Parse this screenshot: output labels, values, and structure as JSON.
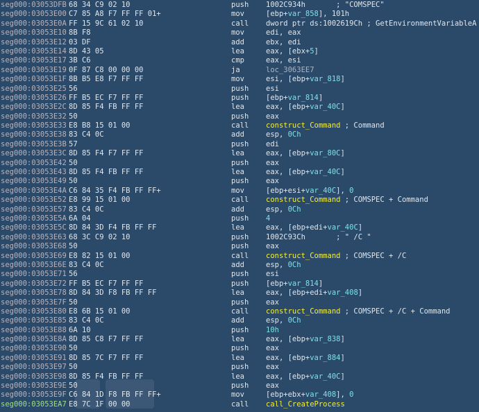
{
  "listing": {
    "rows": [
      {
        "addr": "seg000:03053DFB",
        "bytes": "68 34 C9 02 10",
        "mnemonic": "push",
        "ops": [
          {
            "t": "1002C934h       ; \"COMSPEC\"",
            "c": "plain"
          }
        ]
      },
      {
        "addr": "seg000:03053E00",
        "bytes": "C7 85 A8 F7 FF FF 01+",
        "mnemonic": "mov",
        "ops": [
          {
            "t": "[ebp+",
            "c": "plain"
          },
          {
            "t": "var_858",
            "c": "var"
          },
          {
            "t": "], 101h",
            "c": "plain"
          }
        ]
      },
      {
        "addr": "seg000:03053E0A",
        "bytes": "FF 15 9C 61 02 10",
        "mnemonic": "call",
        "ops": [
          {
            "t": "dword ptr ds:1002619Ch ; GetEnvironmentVariableA",
            "c": "plain"
          }
        ]
      },
      {
        "addr": "seg000:03053E10",
        "bytes": "8B F8",
        "mnemonic": "mov",
        "ops": [
          {
            "t": "edi, eax",
            "c": "plain"
          }
        ]
      },
      {
        "addr": "seg000:03053E12",
        "bytes": "03 DF",
        "mnemonic": "add",
        "ops": [
          {
            "t": "ebx, edi",
            "c": "plain"
          }
        ]
      },
      {
        "addr": "seg000:03053E14",
        "bytes": "8D 43 05",
        "mnemonic": "lea",
        "ops": [
          {
            "t": "eax, [ebx+",
            "c": "plain"
          },
          {
            "t": "5",
            "c": "num"
          },
          {
            "t": "]",
            "c": "plain"
          }
        ]
      },
      {
        "addr": "seg000:03053E17",
        "bytes": "3B C6",
        "mnemonic": "cmp",
        "ops": [
          {
            "t": "eax, esi",
            "c": "plain"
          }
        ]
      },
      {
        "addr": "seg000:03053E19",
        "bytes": "0F 87 C8 00 00 00",
        "mnemonic": "ja",
        "ops": [
          {
            "t": "loc_3063EE7",
            "c": "loc"
          }
        ]
      },
      {
        "addr": "seg000:03053E1F",
        "bytes": "8B B5 E8 F7 FF FF",
        "mnemonic": "mov",
        "ops": [
          {
            "t": "esi, [ebp+",
            "c": "plain"
          },
          {
            "t": "var_818",
            "c": "var"
          },
          {
            "t": "]",
            "c": "plain"
          }
        ]
      },
      {
        "addr": "seg000:03053E25",
        "bytes": "56",
        "mnemonic": "push",
        "ops": [
          {
            "t": "esi",
            "c": "plain"
          }
        ]
      },
      {
        "addr": "seg000:03053E26",
        "bytes": "FF B5 EC F7 FF FF",
        "mnemonic": "push",
        "ops": [
          {
            "t": "[ebp+",
            "c": "plain"
          },
          {
            "t": "var_814",
            "c": "var"
          },
          {
            "t": "]",
            "c": "plain"
          }
        ]
      },
      {
        "addr": "seg000:03053E2C",
        "bytes": "8D 85 F4 FB FF FF",
        "mnemonic": "lea",
        "ops": [
          {
            "t": "eax, [ebp+",
            "c": "plain"
          },
          {
            "t": "var_40C",
            "c": "var"
          },
          {
            "t": "]",
            "c": "plain"
          }
        ]
      },
      {
        "addr": "seg000:03053E32",
        "bytes": "50",
        "mnemonic": "push",
        "ops": [
          {
            "t": "eax",
            "c": "plain"
          }
        ]
      },
      {
        "addr": "seg000:03053E33",
        "bytes": "E8 B8 15 01 00",
        "mnemonic": "call",
        "ops": [
          {
            "t": "construct_Command",
            "c": "func"
          },
          {
            "t": " ; Command",
            "c": "cmt"
          }
        ]
      },
      {
        "addr": "seg000:03053E38",
        "bytes": "83 C4 0C",
        "mnemonic": "add",
        "ops": [
          {
            "t": "esp, ",
            "c": "plain"
          },
          {
            "t": "0Ch",
            "c": "num"
          }
        ]
      },
      {
        "addr": "seg000:03053E3B",
        "bytes": "57",
        "mnemonic": "push",
        "ops": [
          {
            "t": "edi",
            "c": "plain"
          }
        ]
      },
      {
        "addr": "seg000:03053E3C",
        "bytes": "8D 85 F4 F7 FF FF",
        "mnemonic": "lea",
        "ops": [
          {
            "t": "eax, [ebp+",
            "c": "plain"
          },
          {
            "t": "var_80C",
            "c": "var"
          },
          {
            "t": "]",
            "c": "plain"
          }
        ]
      },
      {
        "addr": "seg000:03053E42",
        "bytes": "50",
        "mnemonic": "push",
        "ops": [
          {
            "t": "eax",
            "c": "plain"
          }
        ]
      },
      {
        "addr": "seg000:03053E43",
        "bytes": "8D 85 F4 FB FF FF",
        "mnemonic": "lea",
        "ops": [
          {
            "t": "eax, [ebp+",
            "c": "plain"
          },
          {
            "t": "var_40C",
            "c": "var"
          },
          {
            "t": "]",
            "c": "plain"
          }
        ]
      },
      {
        "addr": "seg000:03053E49",
        "bytes": "50",
        "mnemonic": "push",
        "ops": [
          {
            "t": "eax",
            "c": "plain"
          }
        ]
      },
      {
        "addr": "seg000:03053E4A",
        "bytes": "C6 84 35 F4 FB FF FF+",
        "mnemonic": "mov",
        "ops": [
          {
            "t": "[ebp+esi+",
            "c": "plain"
          },
          {
            "t": "var_40C",
            "c": "var"
          },
          {
            "t": "], ",
            "c": "plain"
          },
          {
            "t": "0",
            "c": "num"
          }
        ]
      },
      {
        "addr": "seg000:03053E52",
        "bytes": "E8 99 15 01 00",
        "mnemonic": "call",
        "ops": [
          {
            "t": "construct_Command",
            "c": "func"
          },
          {
            "t": " ; COMSPEC + Command",
            "c": "cmt"
          }
        ]
      },
      {
        "addr": "seg000:03053E57",
        "bytes": "83 C4 0C",
        "mnemonic": "add",
        "ops": [
          {
            "t": "esp, ",
            "c": "plain"
          },
          {
            "t": "0Ch",
            "c": "num"
          }
        ]
      },
      {
        "addr": "seg000:03053E5A",
        "bytes": "6A 04",
        "mnemonic": "push",
        "ops": [
          {
            "t": "4",
            "c": "num"
          }
        ]
      },
      {
        "addr": "seg000:03053E5C",
        "bytes": "8D 84 3D F4 FB FF FF",
        "mnemonic": "lea",
        "ops": [
          {
            "t": "eax, [ebp+edi+",
            "c": "plain"
          },
          {
            "t": "var_40C",
            "c": "var"
          },
          {
            "t": "]",
            "c": "plain"
          }
        ]
      },
      {
        "addr": "seg000:03053E63",
        "bytes": "68 3C C9 02 10",
        "mnemonic": "push",
        "ops": [
          {
            "t": "1002C93Ch       ; \" /C \"",
            "c": "plain"
          }
        ]
      },
      {
        "addr": "seg000:03053E68",
        "bytes": "50",
        "mnemonic": "push",
        "ops": [
          {
            "t": "eax",
            "c": "plain"
          }
        ]
      },
      {
        "addr": "seg000:03053E69",
        "bytes": "E8 82 15 01 00",
        "mnemonic": "call",
        "ops": [
          {
            "t": "construct_Command",
            "c": "func"
          },
          {
            "t": " ; COMSPEC + /C",
            "c": "cmt"
          }
        ]
      },
      {
        "addr": "seg000:03053E6E",
        "bytes": "83 C4 0C",
        "mnemonic": "add",
        "ops": [
          {
            "t": "esp, ",
            "c": "plain"
          },
          {
            "t": "0Ch",
            "c": "num"
          }
        ]
      },
      {
        "addr": "seg000:03053E71",
        "bytes": "56",
        "mnemonic": "push",
        "ops": [
          {
            "t": "esi",
            "c": "plain"
          }
        ]
      },
      {
        "addr": "seg000:03053E72",
        "bytes": "FF B5 EC F7 FF FF",
        "mnemonic": "push",
        "ops": [
          {
            "t": "[ebp+",
            "c": "plain"
          },
          {
            "t": "var_814",
            "c": "var"
          },
          {
            "t": "]",
            "c": "plain"
          }
        ]
      },
      {
        "addr": "seg000:03053E78",
        "bytes": "8D 84 3D F8 FB FF FF",
        "mnemonic": "lea",
        "ops": [
          {
            "t": "eax, [ebp+edi+",
            "c": "plain"
          },
          {
            "t": "var_408",
            "c": "var"
          },
          {
            "t": "]",
            "c": "plain"
          }
        ]
      },
      {
        "addr": "seg000:03053E7F",
        "bytes": "50",
        "mnemonic": "push",
        "ops": [
          {
            "t": "eax",
            "c": "plain"
          }
        ]
      },
      {
        "addr": "seg000:03053E80",
        "bytes": "E8 6B 15 01 00",
        "mnemonic": "call",
        "ops": [
          {
            "t": "construct_Command",
            "c": "func"
          },
          {
            "t": " ; COMSPEC + /C + Command",
            "c": "cmt"
          }
        ]
      },
      {
        "addr": "seg000:03053E85",
        "bytes": "83 C4 0C",
        "mnemonic": "add",
        "ops": [
          {
            "t": "esp, ",
            "c": "plain"
          },
          {
            "t": "0Ch",
            "c": "num"
          }
        ]
      },
      {
        "addr": "seg000:03053E88",
        "bytes": "6A 10",
        "mnemonic": "push",
        "ops": [
          {
            "t": "10h",
            "c": "num"
          }
        ]
      },
      {
        "addr": "seg000:03053E8A",
        "bytes": "8D 85 C8 F7 FF FF",
        "mnemonic": "lea",
        "ops": [
          {
            "t": "eax, [ebp+",
            "c": "plain"
          },
          {
            "t": "var_838",
            "c": "var"
          },
          {
            "t": "]",
            "c": "plain"
          }
        ]
      },
      {
        "addr": "seg000:03053E90",
        "bytes": "50",
        "mnemonic": "push",
        "ops": [
          {
            "t": "eax",
            "c": "plain"
          }
        ]
      },
      {
        "addr": "seg000:03053E91",
        "bytes": "8D 85 7C F7 FF FF",
        "mnemonic": "lea",
        "ops": [
          {
            "t": "eax, [ebp+",
            "c": "plain"
          },
          {
            "t": "var_884",
            "c": "var"
          },
          {
            "t": "]",
            "c": "plain"
          }
        ]
      },
      {
        "addr": "seg000:03053E97",
        "bytes": "50",
        "mnemonic": "push",
        "ops": [
          {
            "t": "eax",
            "c": "plain"
          }
        ]
      },
      {
        "addr": "seg000:03053E98",
        "bytes": "8D 85 F4 FB FF FF",
        "mnemonic": "lea",
        "ops": [
          {
            "t": "eax, [ebp+",
            "c": "plain"
          },
          {
            "t": "var_40C",
            "c": "var"
          },
          {
            "t": "]",
            "c": "plain"
          }
        ]
      },
      {
        "addr": "seg000:03053E9E",
        "bytes": "50",
        "mnemonic": "push",
        "ops": [
          {
            "t": "eax",
            "c": "plain"
          }
        ]
      },
      {
        "addr": "seg000:03053E9F",
        "bytes": "C6 84 1D F8 FB FF FF+",
        "mnemonic": "mov",
        "ops": [
          {
            "t": "[ebp+ebx+",
            "c": "plain"
          },
          {
            "t": "var_408",
            "c": "var"
          },
          {
            "t": "], ",
            "c": "plain"
          },
          {
            "t": "0",
            "c": "num"
          }
        ]
      },
      {
        "addr": "seg000:03053EA7",
        "bytes": "E8 7C 1F 00 00",
        "mnemonic": "call",
        "ops": [
          {
            "t": "call_CreateProcess",
            "c": "func"
          }
        ]
      }
    ]
  },
  "colors": {
    "background": "#2b4a6a",
    "address": "#b9b3bc",
    "current_address": "#9fe084",
    "text": "#dfe7ee",
    "number_var": "#7fe0e6",
    "function": "#f3ee3c"
  }
}
